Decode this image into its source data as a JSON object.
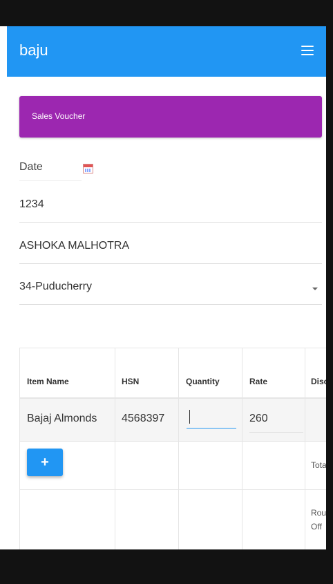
{
  "app": {
    "brand": "baju",
    "menu_icon": "hamburger-icon"
  },
  "voucher": {
    "title": "Sales Voucher",
    "color": "#9C27B0"
  },
  "form": {
    "date_label": "Date",
    "calendar_icon": "calendar-icon",
    "voucher_number": "1234",
    "party_name": "ASHOKA MALHOTRA",
    "state": "34-Puducherry"
  },
  "table": {
    "headers": [
      "Item Name",
      "HSN",
      "Quantity",
      "Rate",
      "Disco"
    ],
    "rows": [
      {
        "item_name": "Bajaj Almonds",
        "hsn": "4568397",
        "quantity": "",
        "rate": "260"
      }
    ],
    "add_button": "+",
    "total_label": "Tota",
    "round_off_label_line1": "Rour",
    "round_off_label_line2": "Off"
  },
  "colors": {
    "navbar": "#2196F3",
    "accent": "#2196F3",
    "voucher": "#9C27B0"
  }
}
